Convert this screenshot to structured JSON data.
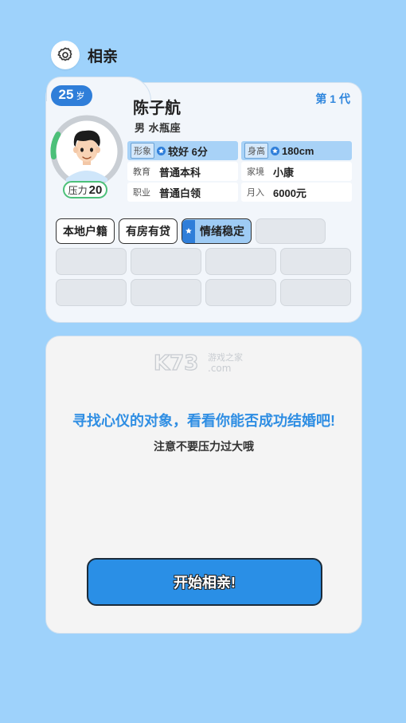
{
  "header": {
    "title": "相亲",
    "settings_icon": "gear-icon"
  },
  "profile": {
    "age": "25",
    "age_unit": "岁",
    "generation": "第 1 代",
    "name": "陈子航",
    "sub": "男 水瓶座",
    "stress_label": "压力",
    "stress_value": "20",
    "stress_ring_fraction": 0.2,
    "attributes": [
      {
        "key": "形象",
        "value": "较好 6分",
        "highlight": true
      },
      {
        "key": "身高",
        "value": "180cm",
        "highlight": true
      },
      {
        "key": "教育",
        "value": "普通本科",
        "highlight": false
      },
      {
        "key": "家境",
        "value": "小康",
        "highlight": false
      },
      {
        "key": "职业",
        "value": "普通白领",
        "highlight": false
      },
      {
        "key": "月入",
        "value": "6000元",
        "highlight": false
      }
    ],
    "tags": [
      {
        "label": "本地户籍"
      },
      {
        "label": "有房有贷"
      },
      {
        "label": "情绪稳定",
        "featured": true
      }
    ]
  },
  "panel": {
    "watermark": "K73 游戏之家 .com",
    "headline": "寻找心仪的对象，看看你能否成功结婚吧!",
    "note": "注意不要压力过大哦",
    "start_button": "开始相亲!"
  },
  "colors": {
    "background": "#9ed2fb",
    "accent": "#2f7ed9",
    "stress_ring": "#4cc079",
    "headline": "#2f8ee3"
  }
}
